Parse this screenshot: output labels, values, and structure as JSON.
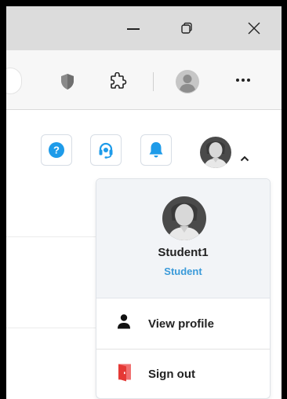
{
  "titlebar": {
    "minimize_icon": "minimize-icon",
    "restore_icon": "restore-icon",
    "close_icon": "close-icon"
  },
  "toolbar": {
    "icons": [
      "shield-icon",
      "puzzle-extensions-icon",
      "profile-icon",
      "more-options-icon"
    ]
  },
  "header": {
    "icons": [
      "help-icon",
      "support-headset-icon",
      "notifications-bell-icon",
      "user-avatar-icon",
      "chevron-up-icon"
    ]
  },
  "profile_menu": {
    "user_name": "Student1",
    "user_role": "Student",
    "items": [
      {
        "label": "View profile",
        "icon": "person-icon"
      },
      {
        "label": "Sign out",
        "icon": "sign-out-door-icon"
      }
    ]
  },
  "colors": {
    "accent": "#1e9be9",
    "role_text": "#3a9ad9",
    "sign_out_red": "#e53935",
    "titlebar_bg": "#dcdcdc",
    "menu_header_bg": "#f2f4f7"
  }
}
